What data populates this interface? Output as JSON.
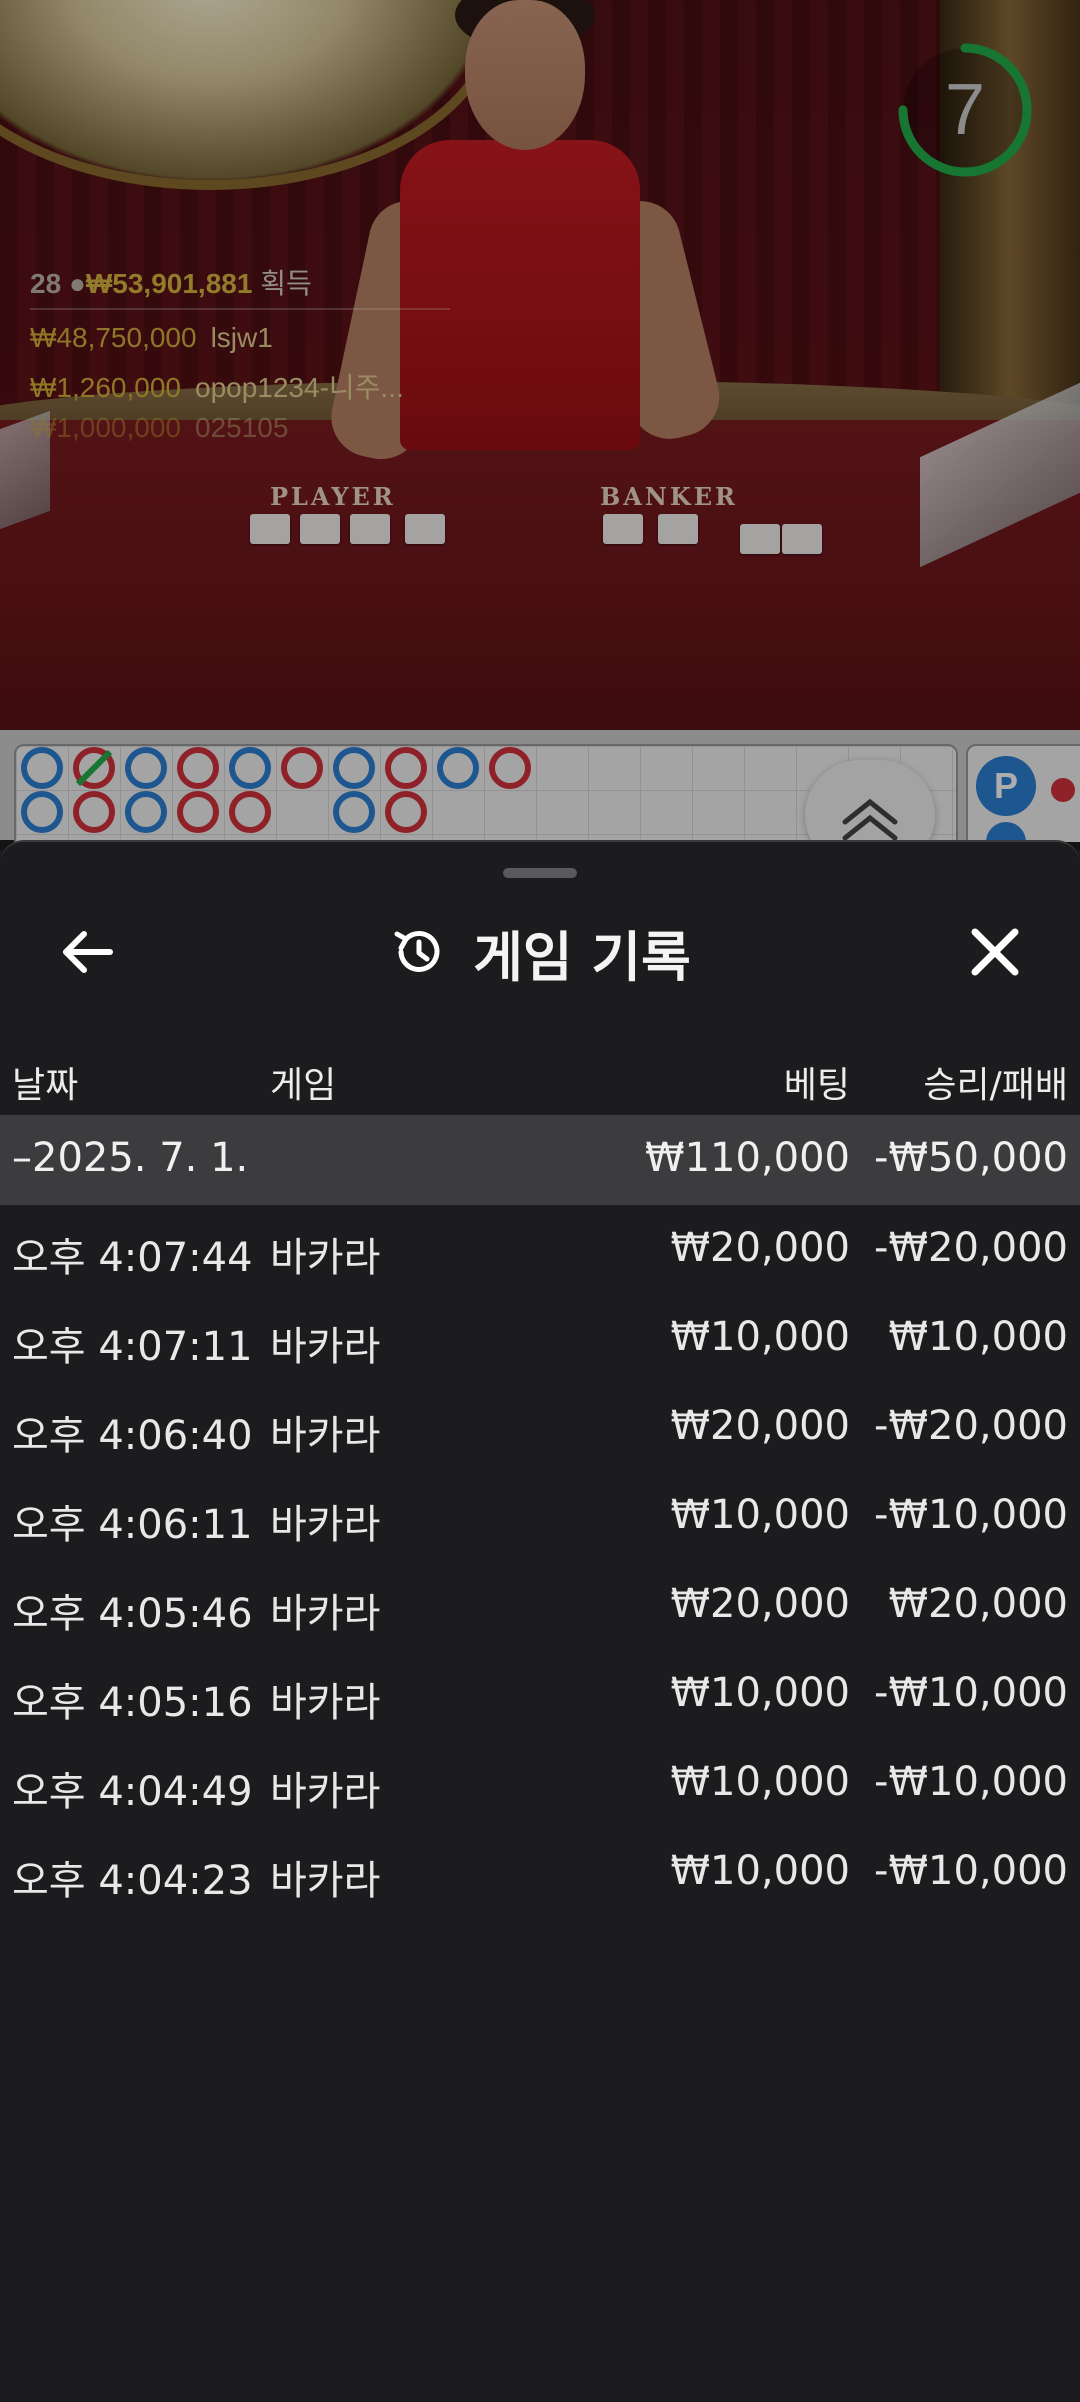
{
  "video": {
    "player_count": "28",
    "total_won": "₩53,901,881",
    "won_label": "획득",
    "winners": [
      {
        "amount": "₩48,750,000",
        "name": "lsjw1"
      },
      {
        "amount": "₩1,260,000",
        "name": "opop1234-니주..."
      },
      {
        "amount": "₩1,000,000",
        "name": "025105"
      }
    ],
    "table_labels": {
      "player": "PLAYER",
      "banker": "BANKER"
    },
    "timer": "7",
    "timer_progress": 0.75,
    "colors": {
      "accent_gold": "#d4b03a",
      "timer_green": "#22b04a",
      "player_blue": "#2d7fd3",
      "banker_red": "#d2333c"
    }
  },
  "roadmap": {
    "bead_road_letter": "P",
    "rows": [
      [
        "player",
        "banker-tie",
        "player",
        "banker",
        "player",
        "banker",
        "player",
        "banker",
        "player",
        "banker"
      ],
      [
        "player",
        "banker",
        "player",
        "banker",
        "banker",
        "",
        "player",
        "banker",
        "",
        ""
      ]
    ]
  },
  "sheet": {
    "title": "게임 기록",
    "icons": {
      "back": "arrow-left-icon",
      "history": "history-icon",
      "close": "close-icon"
    },
    "columns": {
      "date": "날짜",
      "game": "게임",
      "bet": "베팅",
      "win_loss": "승리/패배"
    },
    "date_group": {
      "date": "–2025. 7. 1.",
      "bet_total": "₩110,000",
      "win_loss_total": "-₩50,000"
    },
    "rows": [
      {
        "time": "오후 4:07:44",
        "game": "바카라",
        "bet": "₩20,000",
        "result": "-₩20,000"
      },
      {
        "time": "오후 4:07:11",
        "game": "바카라",
        "bet": "₩10,000",
        "result": "₩10,000"
      },
      {
        "time": "오후 4:06:40",
        "game": "바카라",
        "bet": "₩20,000",
        "result": "-₩20,000"
      },
      {
        "time": "오후 4:06:11",
        "game": "바카라",
        "bet": "₩10,000",
        "result": "-₩10,000"
      },
      {
        "time": "오후 4:05:46",
        "game": "바카라",
        "bet": "₩20,000",
        "result": "₩20,000"
      },
      {
        "time": "오후 4:05:16",
        "game": "바카라",
        "bet": "₩10,000",
        "result": "-₩10,000"
      },
      {
        "time": "오후 4:04:49",
        "game": "바카라",
        "bet": "₩10,000",
        "result": "-₩10,000"
      },
      {
        "time": "오후 4:04:23",
        "game": "바카라",
        "bet": "₩10,000",
        "result": "-₩10,000"
      }
    ]
  }
}
